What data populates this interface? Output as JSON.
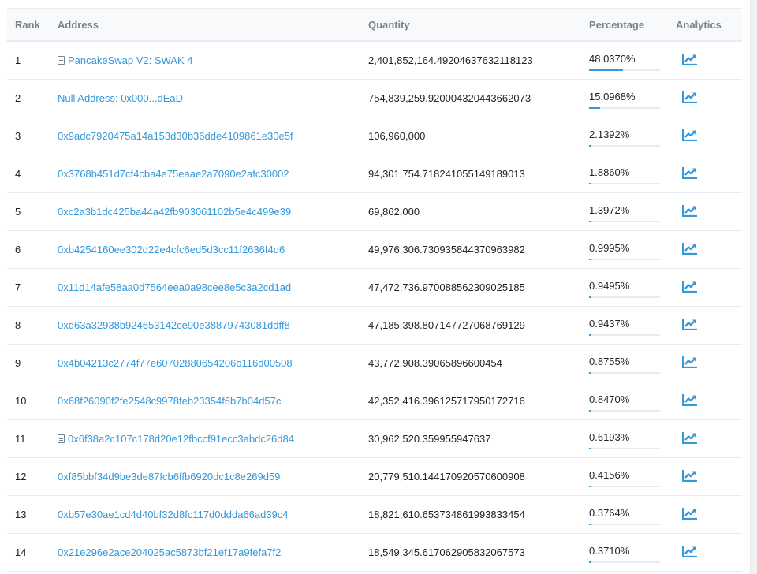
{
  "table": {
    "headers": {
      "rank": "Rank",
      "address": "Address",
      "quantity": "Quantity",
      "percentage": "Percentage",
      "analytics": "Analytics"
    },
    "colors": {
      "link": "#3498db",
      "progress_fill": "#3498db",
      "progress_track": "#e7eaf3"
    },
    "rows": [
      {
        "rank": "1",
        "address": "PancakeSwap V2: SWAK 4",
        "is_contract": true,
        "quantity": "2,401,852,164.49204637632118123",
        "percentage": "48.0370%",
        "percent_value": 48.037
      },
      {
        "rank": "2",
        "address": "Null Address: 0x000...dEaD",
        "is_contract": false,
        "quantity": "754,839,259.920004320443662073",
        "percentage": "15.0968%",
        "percent_value": 15.0968
      },
      {
        "rank": "3",
        "address": "0x9adc7920475a14a153d30b36dde4109861e30e5f",
        "is_contract": false,
        "quantity": "106,960,000",
        "percentage": "2.1392%",
        "percent_value": 2.1392
      },
      {
        "rank": "4",
        "address": "0x3768b451d7cf4cba4e75eaae2a7090e2afc30002",
        "is_contract": false,
        "quantity": "94,301,754.718241055149189013",
        "percentage": "1.8860%",
        "percent_value": 1.886
      },
      {
        "rank": "5",
        "address": "0xc2a3b1dc425ba44a42fb903061102b5e4c499e39",
        "is_contract": false,
        "quantity": "69,862,000",
        "percentage": "1.3972%",
        "percent_value": 1.3972
      },
      {
        "rank": "6",
        "address": "0xb4254160ee302d22e4cfc6ed5d3cc11f2636f4d6",
        "is_contract": false,
        "quantity": "49,976,306.730935844370963982",
        "percentage": "0.9995%",
        "percent_value": 0.9995
      },
      {
        "rank": "7",
        "address": "0x11d14afe58aa0d7564eea0a98cee8e5c3a2cd1ad",
        "is_contract": false,
        "quantity": "47,472,736.970088562309025185",
        "percentage": "0.9495%",
        "percent_value": 0.9495
      },
      {
        "rank": "8",
        "address": "0xd63a32938b924653142ce90e38879743081ddff8",
        "is_contract": false,
        "quantity": "47,185,398.807147727068769129",
        "percentage": "0.9437%",
        "percent_value": 0.9437
      },
      {
        "rank": "9",
        "address": "0x4b04213c2774f77e60702880654206b116d00508",
        "is_contract": false,
        "quantity": "43,772,908.39065896600454",
        "percentage": "0.8755%",
        "percent_value": 0.8755
      },
      {
        "rank": "10",
        "address": "0x68f26090f2fe2548c9978feb23354f6b7b04d57c",
        "is_contract": false,
        "quantity": "42,352,416.396125717950172716",
        "percentage": "0.8470%",
        "percent_value": 0.847
      },
      {
        "rank": "11",
        "address": "0x6f38a2c107c178d20e12fbccf91ecc3abdc26d84",
        "is_contract": true,
        "quantity": "30,962,520.359955947637",
        "percentage": "0.6193%",
        "percent_value": 0.6193
      },
      {
        "rank": "12",
        "address": "0xf85bbf34d9be3de87fcb6ffb6920dc1c8e269d59",
        "is_contract": false,
        "quantity": "20,779,510.144170920570600908",
        "percentage": "0.4156%",
        "percent_value": 0.4156
      },
      {
        "rank": "13",
        "address": "0xb57e30ae1cd4d40bf32d8fc117d0ddda66ad39c4",
        "is_contract": false,
        "quantity": "18,821,610.653734861993833454",
        "percentage": "0.3764%",
        "percent_value": 0.3764
      },
      {
        "rank": "14",
        "address": "0x21e296e2ace204025ac5873bf21ef17a9fefa7f2",
        "is_contract": false,
        "quantity": "18,549,345.617062905832067573",
        "percentage": "0.3710%",
        "percent_value": 0.371
      }
    ],
    "analytics_icon": "chart-line-icon",
    "contract_icon": "file-contract-icon"
  }
}
